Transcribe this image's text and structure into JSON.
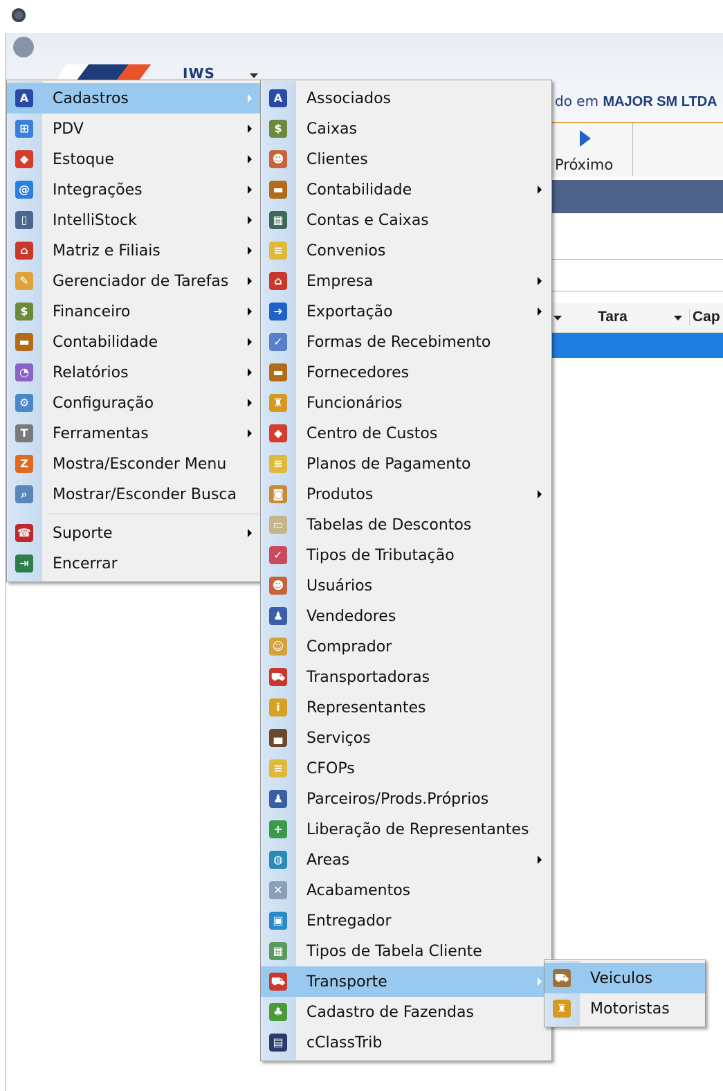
{
  "background": {
    "logo_text": "IWS",
    "company_prefix": "do em ",
    "company_name": "MAJOR SM LTDA",
    "toolbar": {
      "next_label": "Próximo"
    },
    "grid": {
      "columns": [
        "Tara",
        "Cap"
      ]
    }
  },
  "menus": {
    "main": [
      {
        "label": "Cadastros",
        "icon": "binoculars-icon",
        "color": "#2b4aa8",
        "glyph": "A",
        "submenu": true,
        "highlighted": true
      },
      {
        "label": "PDV",
        "icon": "cart-icon",
        "color": "#3b7fd6",
        "glyph": "⊞",
        "submenu": true
      },
      {
        "label": "Estoque",
        "icon": "boxes-icon",
        "color": "#d63b2b",
        "glyph": "◆",
        "submenu": true
      },
      {
        "label": "Integrações",
        "icon": "at-icon",
        "color": "#2a7fe0",
        "glyph": "@",
        "submenu": true
      },
      {
        "label": "IntelliStock",
        "icon": "device-icon",
        "color": "#4b6790",
        "glyph": "▯",
        "submenu": true
      },
      {
        "label": "Matriz e Filiais",
        "icon": "house-icon",
        "color": "#c9382b",
        "glyph": "⌂",
        "submenu": true
      },
      {
        "label": "Gerenciador de Tarefas",
        "icon": "clipboard-icon",
        "color": "#e0a23a",
        "glyph": "✎",
        "submenu": true
      },
      {
        "label": "Financeiro",
        "icon": "moneybag-icon",
        "color": "#6c8a3c",
        "glyph": "$",
        "submenu": true
      },
      {
        "label": "Contabilidade",
        "icon": "briefcase-icon",
        "color": "#b36b18",
        "glyph": "▬",
        "submenu": true
      },
      {
        "label": "Relatórios",
        "icon": "chart-icon",
        "color": "#8a63c9",
        "glyph": "◔",
        "submenu": true
      },
      {
        "label": "Configuração",
        "icon": "config-icon",
        "color": "#4a87c9",
        "glyph": "⚙",
        "submenu": true
      },
      {
        "label": "Ferramentas",
        "icon": "hammer-icon",
        "color": "#7a7a7a",
        "glyph": "T",
        "submenu": true
      },
      {
        "label": "Mostra/Esconder Menu",
        "icon": "menu-toggle-icon",
        "color": "#e06b1f",
        "glyph": "Z",
        "submenu": false
      },
      {
        "label": "Mostrar/Esconder Busca",
        "icon": "search-icon",
        "color": "#5a87b8",
        "glyph": "⌕",
        "submenu": false
      },
      {
        "separator": true
      },
      {
        "label": "Suporte",
        "icon": "phone-icon",
        "color": "#c0282b",
        "glyph": "☎",
        "submenu": true
      },
      {
        "label": "Encerrar",
        "icon": "exit-icon",
        "color": "#2e7d4a",
        "glyph": "⇥",
        "submenu": false
      }
    ],
    "cadastros": [
      {
        "label": "Associados",
        "icon": "binoculars-icon",
        "color": "#2b4aa8",
        "glyph": "A",
        "submenu": false
      },
      {
        "label": "Caixas",
        "icon": "moneybag-icon",
        "color": "#6c8a3c",
        "glyph": "$",
        "submenu": false
      },
      {
        "label": "Clientes",
        "icon": "users-icon",
        "color": "#c9643a",
        "glyph": "☻",
        "submenu": false
      },
      {
        "label": "Contabilidade",
        "icon": "briefcase-icon",
        "color": "#b36b18",
        "glyph": "▬",
        "submenu": true
      },
      {
        "label": "Contas e Caixas",
        "icon": "register-icon",
        "color": "#3d6a58",
        "glyph": "▦",
        "submenu": false
      },
      {
        "label": "Convenios",
        "icon": "notepad-icon",
        "color": "#e0b83a",
        "glyph": "≡",
        "submenu": false
      },
      {
        "label": "Empresa",
        "icon": "house-icon",
        "color": "#c9382b",
        "glyph": "⌂",
        "submenu": true
      },
      {
        "label": "Exportação",
        "icon": "arrow-right-icon",
        "color": "#1f63c9",
        "glyph": "➜",
        "submenu": true
      },
      {
        "label": "Formas de Recebimento",
        "icon": "check-icon",
        "color": "#5a7fc9",
        "glyph": "✓",
        "submenu": false
      },
      {
        "label": "Fornecedores",
        "icon": "briefcase-icon",
        "color": "#b36b18",
        "glyph": "▬",
        "submenu": false
      },
      {
        "label": "Funcionários",
        "icon": "worker-icon",
        "color": "#d69a1f",
        "glyph": "♜",
        "submenu": false
      },
      {
        "label": "Centro de Custos",
        "icon": "boxes-icon",
        "color": "#d63b2b",
        "glyph": "◆",
        "submenu": false
      },
      {
        "label": "Planos de Pagamento",
        "icon": "notepad-icon",
        "color": "#e0b83a",
        "glyph": "≡",
        "submenu": false
      },
      {
        "label": "Produtos",
        "icon": "package-icon",
        "color": "#c98a3a",
        "glyph": "◙",
        "submenu": true
      },
      {
        "label": "Tabelas de Descontos",
        "icon": "document-icon",
        "color": "#c7b48a",
        "glyph": "▭",
        "submenu": false
      },
      {
        "label": "Tipos de Tributação",
        "icon": "check-icon",
        "color": "#c94a5a",
        "glyph": "✓",
        "submenu": false
      },
      {
        "label": "Usuários",
        "icon": "users-icon",
        "color": "#c9643a",
        "glyph": "☻",
        "submenu": false
      },
      {
        "label": "Vendedores",
        "icon": "salesman-icon",
        "color": "#3a5fa8",
        "glyph": "♟",
        "submenu": false
      },
      {
        "label": "Comprador",
        "icon": "person-icon",
        "color": "#d6a23a",
        "glyph": "☺",
        "submenu": false
      },
      {
        "label": "Transportadoras",
        "icon": "truck-icon",
        "color": "#c9382b",
        "glyph": "⛟",
        "submenu": false
      },
      {
        "label": "Representantes",
        "icon": "agent-icon",
        "color": "#d6a21f",
        "glyph": "i",
        "submenu": false
      },
      {
        "label": "Serviços",
        "icon": "toolbox-icon",
        "color": "#6a4a2a",
        "glyph": "▄",
        "submenu": false
      },
      {
        "label": "CFOPs",
        "icon": "notepad-icon",
        "color": "#e0b83a",
        "glyph": "≡",
        "submenu": false
      },
      {
        "label": "Parceiros/Prods.Próprios",
        "icon": "salesman-icon",
        "color": "#3a5fa8",
        "glyph": "♟",
        "submenu": false
      },
      {
        "label": "Liberação de Representantes",
        "icon": "person-plus-icon",
        "color": "#3a9a4a",
        "glyph": "+",
        "submenu": false
      },
      {
        "label": "Areas",
        "icon": "globe-icon",
        "color": "#2a8ab8",
        "glyph": "◍",
        "submenu": true
      },
      {
        "label": "Acabamentos",
        "icon": "tools-icon",
        "color": "#8aa0b8",
        "glyph": "✕",
        "submenu": false
      },
      {
        "label": "Entregador",
        "icon": "van-icon",
        "color": "#2a8ac9",
        "glyph": "▣",
        "submenu": false
      },
      {
        "label": "Tipos de Tabela Cliente",
        "icon": "table-icon",
        "color": "#5a9a5a",
        "glyph": "▦",
        "submenu": false
      },
      {
        "label": "Transporte",
        "icon": "truck-icon",
        "color": "#c9382b",
        "glyph": "⛟",
        "submenu": true,
        "highlighted": true
      },
      {
        "label": "Cadastro de Fazendas",
        "icon": "farm-icon",
        "color": "#4a9a3a",
        "glyph": "♣",
        "submenu": false
      },
      {
        "label": "cClassTrib",
        "icon": "calculator-icon",
        "color": "#2a3a6a",
        "glyph": "▤",
        "submenu": false
      }
    ],
    "transporte": [
      {
        "label": "Veiculos",
        "icon": "vehicle-icon",
        "color": "#a0703a",
        "glyph": "⛟",
        "submenu": false,
        "highlighted": true
      },
      {
        "label": "Motoristas",
        "icon": "worker-icon",
        "color": "#d69a1f",
        "glyph": "♜",
        "submenu": false
      }
    ]
  }
}
